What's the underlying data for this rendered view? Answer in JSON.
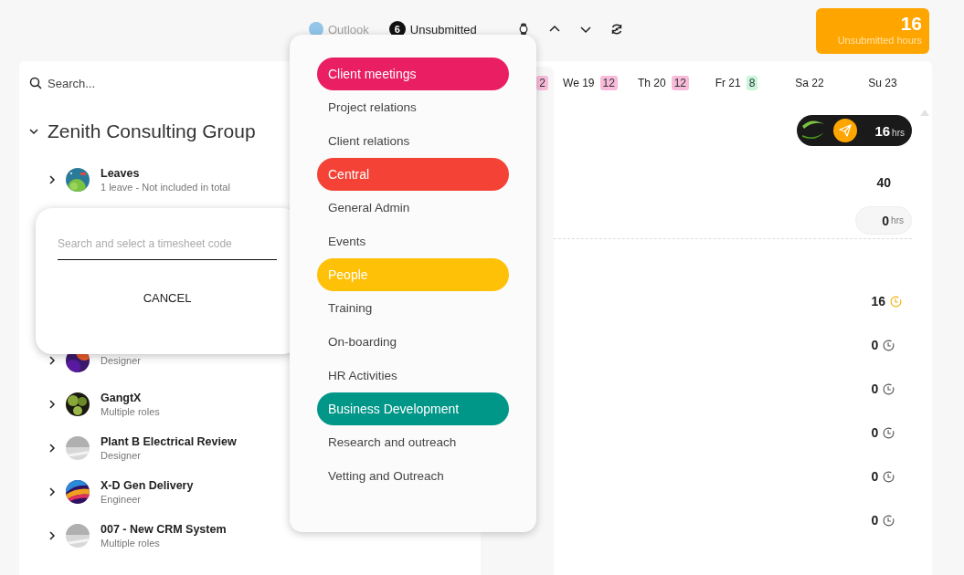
{
  "toolbar": {
    "outlook": {
      "label": "Outlook",
      "disabled": true
    },
    "unsubmitted": {
      "count": "6",
      "label": "Unsubmitted"
    }
  },
  "unsubmitted_hours": {
    "value": "16",
    "label": "Unsubmitted hours"
  },
  "sidebar": {
    "search": {
      "placeholder": "Search..."
    },
    "group": {
      "title": "Zenith Consulting Group",
      "expanded": true
    },
    "projects": [
      {
        "name": "Leaves",
        "role": "1 leave - Not included in total",
        "expanded": false
      },
      {
        "role": "Designer",
        "expanded": false
      },
      {
        "name": "GangtX",
        "role": "Multiple roles",
        "expanded": false
      },
      {
        "name": "Plant B Electrical Review",
        "role": "Designer",
        "expanded": false
      },
      {
        "name": "X-D Gen Delivery",
        "role": "Engineer",
        "expanded": false
      },
      {
        "name": "007 - New CRM System",
        "role": "Multiple roles",
        "expanded": false
      }
    ]
  },
  "week": {
    "days": [
      {
        "badge": "2",
        "over": true
      },
      {
        "label": "We 19",
        "badge": "12",
        "over": true
      },
      {
        "label": "Th 20",
        "badge": "12",
        "over": true
      },
      {
        "label": "Fr 21",
        "badge": "8",
        "over": false
      },
      {
        "label": "Sa 22"
      },
      {
        "label": "Su 23"
      }
    ],
    "submit": {
      "hours": "16",
      "unit": "hrs"
    },
    "total": "40",
    "leave": {
      "hours": "0",
      "unit": "hrs"
    },
    "row_totals": [
      {
        "value": "16",
        "unsubmitted": true
      },
      {
        "value": "0",
        "unsubmitted": false
      },
      {
        "value": "0",
        "unsubmitted": false
      },
      {
        "value": "0",
        "unsubmitted": false
      },
      {
        "value": "0",
        "unsubmitted": false
      },
      {
        "value": "0",
        "unsubmitted": false
      }
    ]
  },
  "code_dialog": {
    "placeholder": "Search and select a timesheet code",
    "cancel": "CANCEL"
  },
  "code_menu": [
    {
      "category": "Client meetings",
      "color": "#e91e63",
      "items": [
        "Project relations",
        "Client relations"
      ]
    },
    {
      "category": "Central",
      "color": "#f44336",
      "items": [
        "General Admin",
        "Events"
      ]
    },
    {
      "category": "People",
      "color": "#ffc107",
      "items": [
        "Training",
        "On-boarding",
        "HR Activities"
      ]
    },
    {
      "category": "Business Development",
      "color": "#009688",
      "items": [
        "Research and outreach",
        "Vetting and Outreach"
      ]
    }
  ]
}
